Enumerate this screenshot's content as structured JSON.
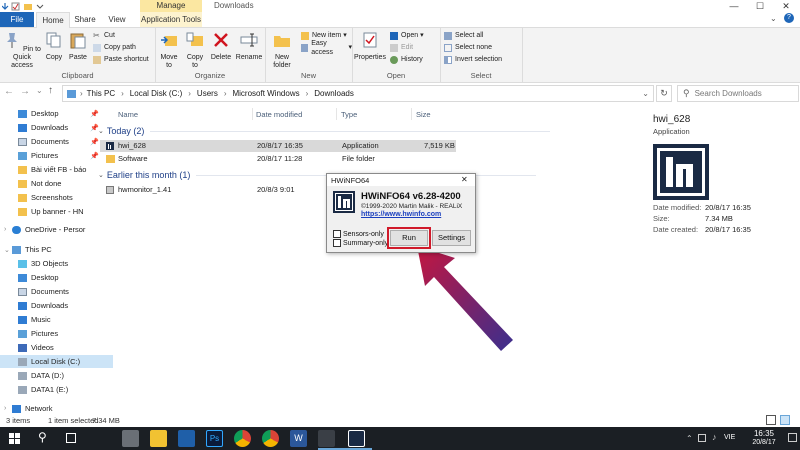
{
  "window": {
    "title": "Downloads",
    "manage_tab": "Manage",
    "min": "—",
    "max": "☐",
    "close": "✕"
  },
  "ribbon_tabs": {
    "file": "File",
    "home": "Home",
    "share": "Share",
    "view": "View",
    "app_tools": "Application Tools"
  },
  "clipboard": {
    "pin": "Pin to Quick access",
    "copy": "Copy",
    "paste": "Paste",
    "cut": "Cut",
    "copy_path": "Copy path",
    "paste_shortcut": "Paste shortcut",
    "label": "Clipboard"
  },
  "organize": {
    "move_to": "Move to",
    "copy_to": "Copy to",
    "delete": "Delete",
    "rename": "Rename",
    "label": "Organize"
  },
  "new": {
    "new_folder": "New folder",
    "new_item": "New item",
    "easy_access": "Easy access",
    "label": "New"
  },
  "open": {
    "properties": "Properties",
    "open": "Open",
    "edit": "Edit",
    "history": "History",
    "label": "Open"
  },
  "select": {
    "select_all": "Select all",
    "select_none": "Select none",
    "invert": "Invert selection",
    "label": "Select"
  },
  "address": {
    "path": [
      "This PC",
      "Local Disk (C:)",
      "Users",
      "Microsoft Windows",
      "Downloads"
    ],
    "search_placeholder": "Search Downloads"
  },
  "sidebar": {
    "quick": [
      "Desktop",
      "Downloads",
      "Documents",
      "Pictures",
      "Bài viết FB - báo",
      "Not done",
      "Screenshots",
      "Up banner - HN"
    ],
    "onedrive": "OneDrive - Persor",
    "thispc": "This PC",
    "pc_items": [
      "3D Objects",
      "Desktop",
      "Documents",
      "Downloads",
      "Music",
      "Pictures",
      "Videos",
      "Local Disk (C:)",
      "DATA (D:)",
      "DATA1 (E:)"
    ],
    "network": "Network"
  },
  "columns": {
    "name": "Name",
    "date": "Date modified",
    "type": "Type",
    "size": "Size"
  },
  "groups": {
    "today": "Today (2)",
    "earlier": "Earlier this month (1)"
  },
  "files": [
    {
      "name": "hwi_628",
      "date": "20/8/17 16:35",
      "type": "Application",
      "size": "7,519 KB"
    },
    {
      "name": "Software",
      "date": "20/8/17 11:28",
      "type": "File folder",
      "size": ""
    },
    {
      "name": "hwmonitor_1.41",
      "date": "20/8/3 9:01",
      "type": "",
      "size": ""
    }
  ],
  "details": {
    "name": "hwi_628",
    "type": "Application",
    "modified_label": "Date modified:",
    "modified": "20/8/17 16:35",
    "size_label": "Size:",
    "size": "7.34 MB",
    "created_label": "Date created:",
    "created": "20/8/17 16:35"
  },
  "status": {
    "items": "3 items",
    "selected": "1 item selected",
    "size": "7.34 MB"
  },
  "dialog": {
    "title": "HWiNFO64",
    "close": "✕",
    "product": "HWiNFO64 v6.28-4200",
    "copyright": "©1999-2020 Martin Malik - REALiX",
    "url": "https://www.hwinfo.com",
    "sensors_only": "Sensors-only",
    "summary_only": "Summary-only",
    "run": "Run",
    "settings": "Settings"
  },
  "taskbar": {
    "time": "16:35",
    "date": "20/8/17",
    "lang": "VIE"
  },
  "colors": {
    "accent": "#1e66b8",
    "manage": "#fbe7a1",
    "arrow_start": "#c4163f",
    "arrow_end": "#3a2f8e",
    "highlight": "#d01a2a"
  }
}
